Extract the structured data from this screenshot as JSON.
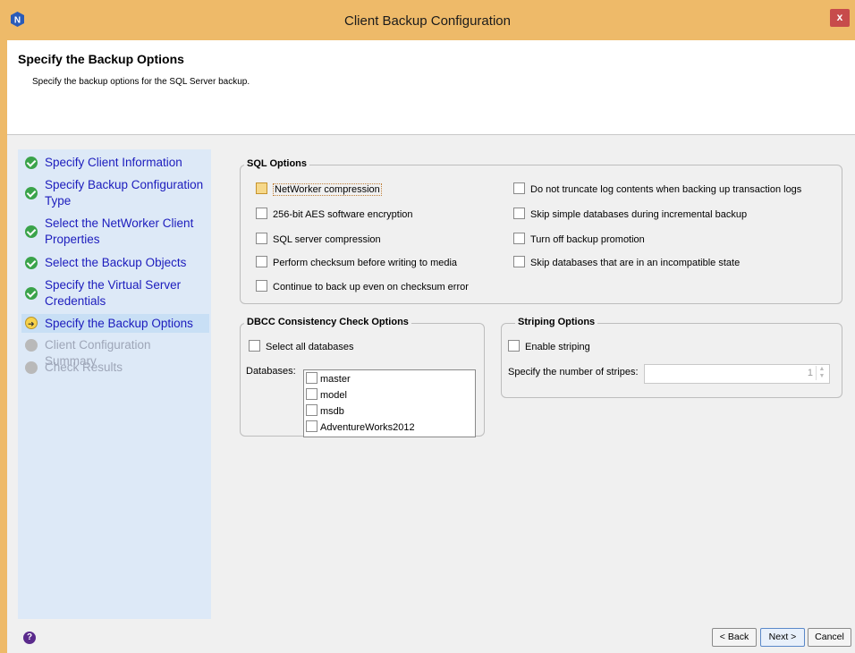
{
  "window": {
    "title": "Client Backup Configuration",
    "close_label": "x",
    "app_icon": "networker-logo",
    "accent": "#eeba69"
  },
  "header": {
    "title": "Specify the Backup Options",
    "subtitle": "Specify the backup options for the SQL Server backup."
  },
  "steps": [
    {
      "label": "Specify Client Information",
      "status": "done"
    },
    {
      "label": "Specify Backup Configuration Type",
      "status": "done"
    },
    {
      "label": "Select the NetWorker Client Properties",
      "status": "done"
    },
    {
      "label": "Select the Backup Objects",
      "status": "done"
    },
    {
      "label": "Specify the Virtual Server Credentials",
      "status": "done"
    },
    {
      "label": "Specify the Backup Options",
      "status": "current"
    },
    {
      "label": "Client Configuration Summary",
      "status": "pending"
    },
    {
      "label": "Check Results",
      "status": "pending"
    }
  ],
  "sql_options": {
    "legend": "SQL Options",
    "left": [
      {
        "label": "NetWorker compression",
        "checked": false
      },
      {
        "label": "256-bit AES software encryption",
        "checked": false
      },
      {
        "label": "SQL server compression",
        "checked": false
      },
      {
        "label": "Perform checksum before writing to media",
        "checked": false
      },
      {
        "label": "Continue to back up even on checksum error",
        "checked": false
      }
    ],
    "right": [
      {
        "label": "Do not truncate log contents when backing up transaction logs",
        "checked": false
      },
      {
        "label": "Skip simple databases during incremental backup",
        "checked": false
      },
      {
        "label": "Turn off backup promotion",
        "checked": false
      },
      {
        "label": "Skip databases that are in an incompatible state",
        "checked": false
      }
    ]
  },
  "dbcc": {
    "legend": "DBCC Consistency Check Options",
    "select_all": "Select all databases",
    "databases_label": "Databases:",
    "databases": [
      "master",
      "model",
      "msdb",
      "AdventureWorks2012"
    ]
  },
  "striping": {
    "legend": "Striping Options",
    "enable": "Enable striping",
    "stripes_label": "Specify the number of stripes:",
    "stripes_value": "1"
  },
  "footer": {
    "help": "?",
    "back": "< Back",
    "next": "Next >",
    "cancel": "Cancel"
  }
}
